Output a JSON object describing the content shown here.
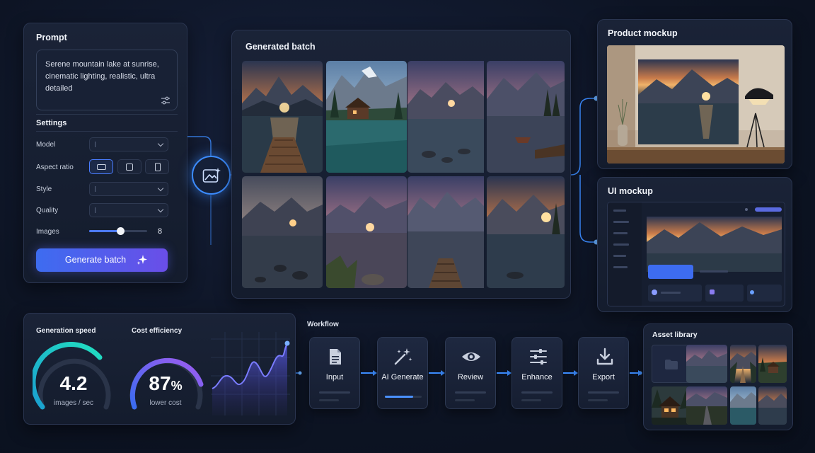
{
  "prompt_panel": {
    "title": "Prompt",
    "prompt_text": "Serene mountain lake at sunrise, cinematic lighting, realistic, ultra detailed",
    "settings_title": "Settings",
    "model_label": "Model",
    "aspect_label": "Aspect ratio",
    "style_label": "Style",
    "quality_label": "Quality",
    "images_label": "Images",
    "images_value": "8",
    "images_slider_fraction": 0.5,
    "generate_label": "Generate batch"
  },
  "batch_panel": {
    "title": "Generated batch"
  },
  "product_panel": {
    "title": "Product mockup"
  },
  "ui_panel": {
    "title": "UI mockup"
  },
  "metrics": {
    "speed_title": "Generation speed",
    "speed_value": "4.2",
    "speed_unit": "images / sec",
    "cost_title": "Cost efficiency",
    "cost_value": "87",
    "cost_pct": "%",
    "cost_sub": "lower cost"
  },
  "workflow": {
    "title": "Workflow",
    "steps": [
      {
        "label": "Input",
        "icon": "document-icon"
      },
      {
        "label": "AI Generate",
        "icon": "magic-wand-icon"
      },
      {
        "label": "Review",
        "icon": "eye-icon"
      },
      {
        "label": "Enhance",
        "icon": "sliders-icon"
      },
      {
        "label": "Export",
        "icon": "download-icon"
      }
    ]
  },
  "asset_library": {
    "title": "Asset library"
  },
  "colors": {
    "accent_blue": "#3c8cff",
    "accent_purple": "#7a52e8",
    "teal": "#1fd3c2"
  }
}
